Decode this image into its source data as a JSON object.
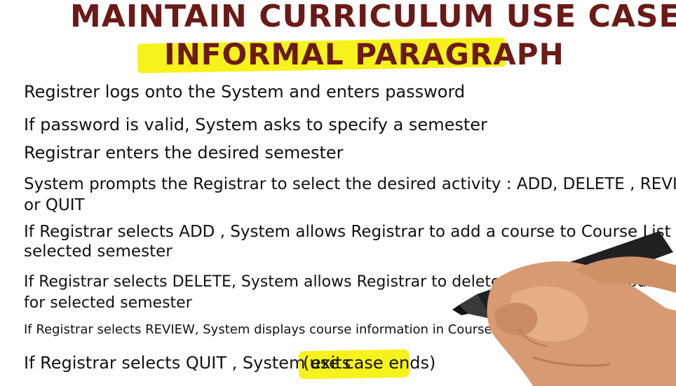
{
  "title": {
    "line1": "MAINTAIN CURRICULUM USE CASE :",
    "line2": "INFORMAL PARAGRAPH"
  },
  "steps": [
    "Registrer logs onto the System and enters password",
    "If password is valid, System asks to specify a semester",
    "Registrar enters the desired semester",
    "System prompts the Registrar to select the desired activity : ADD, DELETE , REVIEW",
    "or QUIT",
    "If Registrar selects ADD , System allows Registrar to add a course to Course List for",
    "selected semester",
    "If Registrar selects DELETE, System allows Registrar to delete a course from Course List",
    "for selected semester",
    "If Registrar selects REVIEW, System displays course information in Course List for selected semester",
    "If Registrar selects QUIT , System exits",
    "(use case ends)"
  ],
  "colors": {
    "title": "#6b1a17",
    "highlight": "#f7f21c",
    "ink": "#111111"
  }
}
